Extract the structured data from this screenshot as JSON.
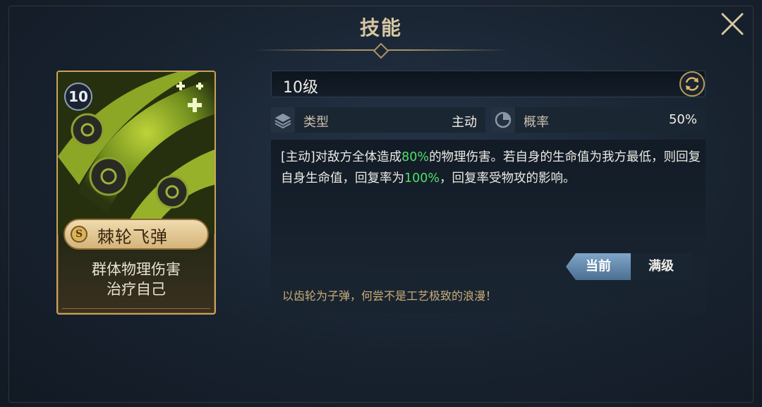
{
  "dialog": {
    "title": "技能"
  },
  "card": {
    "level": "10",
    "rank": "S",
    "name": "棘轮飞弹",
    "desc_line1": "群体物理伤害",
    "desc_line2": "治疗自己"
  },
  "detail": {
    "level_text": "10级",
    "type_label": "类型",
    "type_value": "主动",
    "prob_label": "概率",
    "prob_value": "50%",
    "desc_part1": "[主动]对敌方全体造成",
    "desc_hl1": "80%",
    "desc_part2": "的物理伤害。若自身的生命值为我方最低，则回复自身生命值，回复率为",
    "desc_hl2": "100%",
    "desc_part3": "，回复率受物攻的影响。",
    "tab_current": "当前",
    "tab_max": "满级",
    "flavor": "以齿轮为子弹，何尝不是工艺极致的浪漫！"
  },
  "colors": {
    "highlight": "#4fe06a",
    "gold": "#d6c7a2",
    "card_border": "#c9a35a"
  },
  "icons": [
    "close-icon",
    "refresh-icon",
    "layers-icon",
    "pie-chart-icon",
    "gear-spike-icon"
  ]
}
